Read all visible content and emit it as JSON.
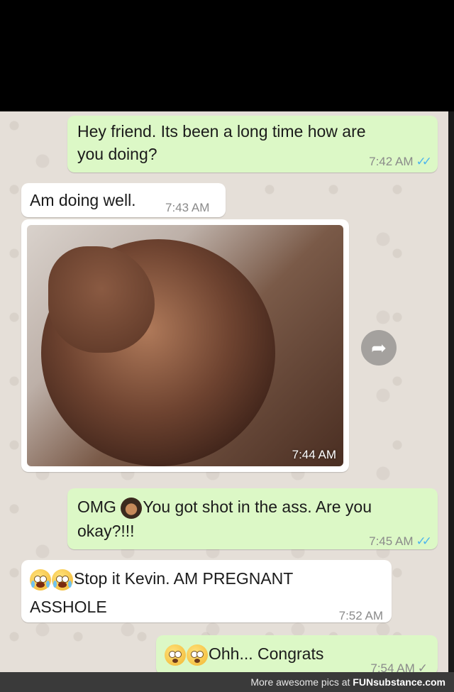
{
  "messages": {
    "m1": {
      "line1": "Hey friend. Its been a long time how are",
      "line2": "you doing?",
      "time": "7:42 AM",
      "ticks": "✓✓"
    },
    "m2": {
      "text": "Am doing well.",
      "time": "7:43 AM"
    },
    "m3": {
      "time": "7:44 AM"
    },
    "m4": {
      "prefix": "OMG",
      "suffix": "You got shot in the ass. Are you",
      "line2": "okay?!!!",
      "time": "7:45 AM",
      "ticks": "✓✓"
    },
    "m5": {
      "line1": "Stop it Kevin. AM PREGNANT",
      "line2": "ASSHOLE",
      "time": "7:52 AM"
    },
    "m6": {
      "text": "Ohh... Congrats",
      "time": "7:54 AM",
      "ticks": "✓"
    }
  },
  "footer": {
    "text": "More awesome pics at",
    "brand": "FUNsubstance.com"
  },
  "colors": {
    "outgoing": "#dcf8c6",
    "incoming": "#ffffff",
    "read_ticks": "#4fb6ec"
  },
  "icons": {
    "forward": "forward-arrow-icon"
  }
}
